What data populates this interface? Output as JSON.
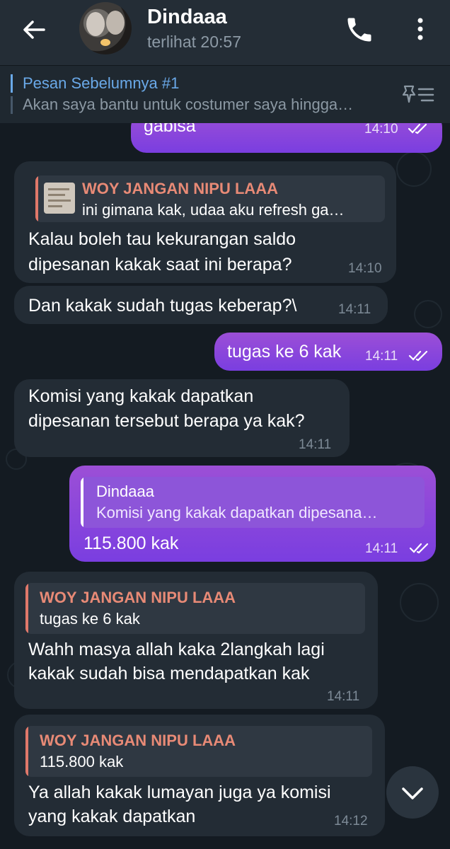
{
  "header": {
    "contact_name": "Dindaaa",
    "last_seen": "terlihat 20:57"
  },
  "pinned": {
    "title": "Pesan Sebelumnya #1",
    "text": "Akan saya bantu untuk costumer saya hingga…"
  },
  "colors": {
    "header_bg": "#242d36",
    "chat_bg": "#141b22",
    "incoming_bubble": "#232c35",
    "outgoing_bubble": "#8a45dc",
    "reply_name_incoming": "#e88a76",
    "link_blue": "#6aa9e8"
  },
  "messages": [
    {
      "dir": "out",
      "text": "gabisa",
      "time": "14:10",
      "ticks": "double-check"
    },
    {
      "dir": "in",
      "reply_name": "WOY JANGAN NIPU LAAA",
      "reply_text": "ini gimana kak, udaa aku refresh ga…",
      "lines": [
        "Kalau boleh tau kekurangan saldo",
        "dipesanan kakak saat ini berapa?"
      ],
      "time": "14:10"
    },
    {
      "dir": "in",
      "text": "Dan kakak sudah tugas keberap?\\",
      "time": "14:11"
    },
    {
      "dir": "out",
      "text": "tugas ke 6 kak",
      "time": "14:11",
      "ticks": "double-check"
    },
    {
      "dir": "in",
      "lines": [
        "Komisi yang kakak dapatkan",
        "dipesanan tersebut berapa ya kak?"
      ],
      "time": "14:11"
    },
    {
      "dir": "out",
      "reply_name": "Dindaaa",
      "reply_text": "Komisi yang kakak dapatkan dipesana…",
      "text": "115.800 kak",
      "time": "14:11",
      "ticks": "double-check"
    },
    {
      "dir": "in",
      "reply_name": "WOY JANGAN NIPU LAAA",
      "reply_text": "tugas ke 6 kak",
      "lines": [
        "Wahh masya allah kaka 2langkah lagi",
        "kakak sudah bisa mendapatkan kak"
      ],
      "time": "14:11"
    },
    {
      "dir": "in",
      "reply_name": "WOY JANGAN NIPU LAAA",
      "reply_text": "115.800 kak",
      "lines": [
        "Ya allah kakak lumayan juga ya komisi",
        "yang kakak dapatkan"
      ],
      "time": "14:12"
    }
  ]
}
